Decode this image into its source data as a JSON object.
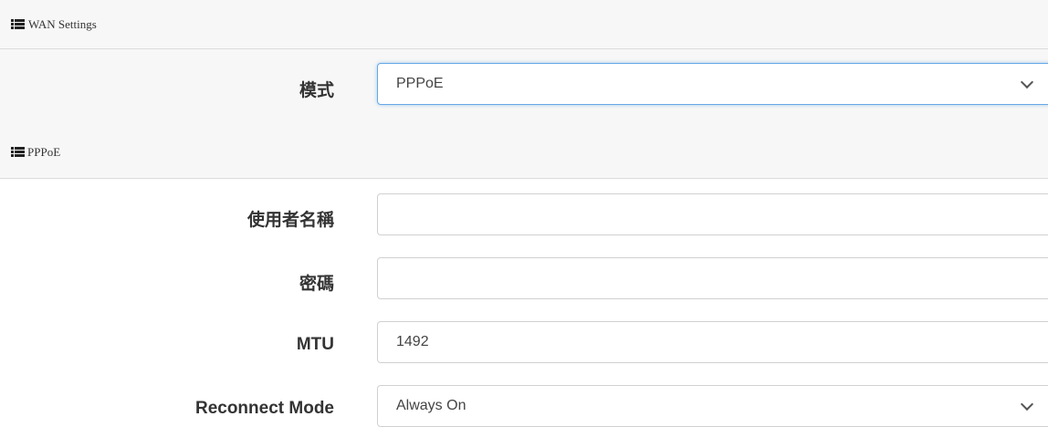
{
  "sections": {
    "wan": {
      "title": "WAN Settings",
      "icon": "list-icon"
    },
    "pppoe": {
      "title": "PPPoE",
      "icon": "list-icon"
    }
  },
  "wan_form": {
    "mode": {
      "label": "模式",
      "value": "PPPoE"
    }
  },
  "pppoe_form": {
    "username": {
      "label": "使用者名稱",
      "value": ""
    },
    "password": {
      "label": "密碼",
      "value": ""
    },
    "mtu": {
      "label": "MTU",
      "value": "1492"
    },
    "reconnect": {
      "label": "Reconnect Mode",
      "value": "Always On"
    }
  },
  "colors": {
    "header_bg": "#f7f7f7",
    "focus_border": "#66a8e6",
    "field_border": "#d0d0d0"
  }
}
